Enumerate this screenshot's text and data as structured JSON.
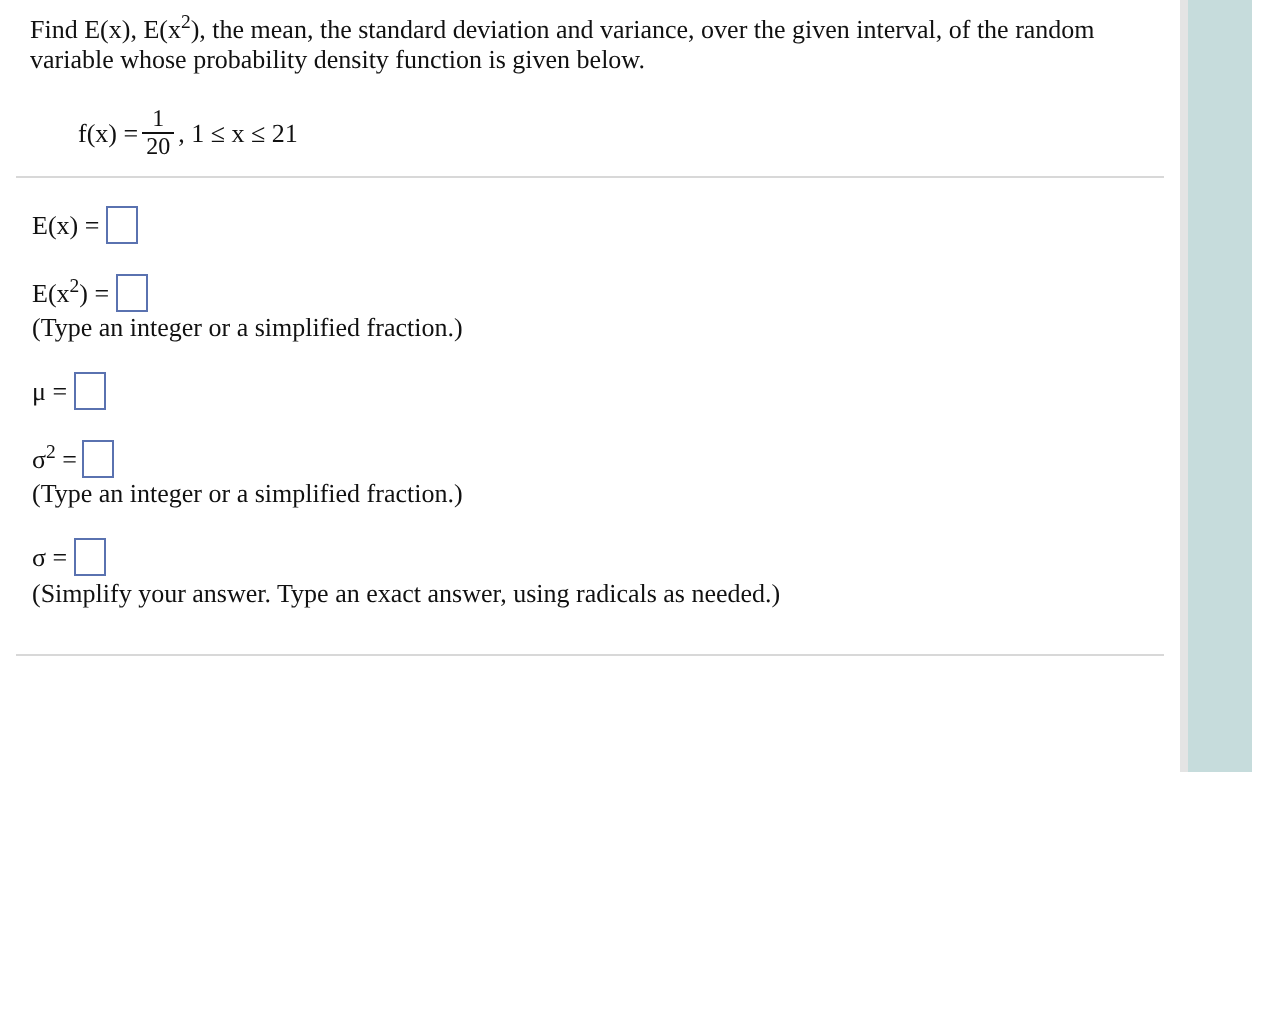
{
  "question": "Find E(x), E(x$^{2}$), the mean, the standard deviation and variance, over the given interval, of the random variable whose probability density function is given below.",
  "formula": {
    "lhs": "f(x) =",
    "numerator": "1",
    "denominator": "20",
    "tail": ", 1 ≤ x ≤ 21"
  },
  "answers": [
    {
      "label": "E(x) ="
    },
    {
      "label": "E(x$^{2}$) =",
      "hint": "(Type an integer or a simplified fraction.)"
    },
    {
      "label": "μ ="
    },
    {
      "label": "σ$^{2}$ =",
      "hint": "(Type an integer or a simplified fraction.)"
    },
    {
      "label": "σ =",
      "hint": "(Simplify your answer. Type an exact answer, using radicals as needed.)"
    }
  ]
}
